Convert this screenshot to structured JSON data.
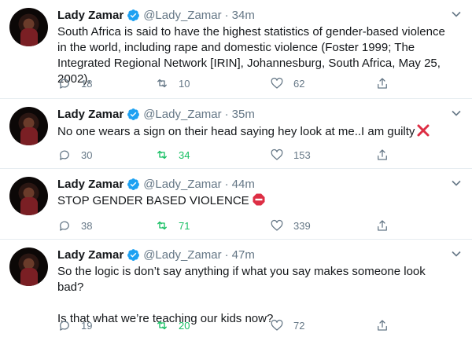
{
  "tweets": [
    {
      "name": "Lady Zamar",
      "handle": "@Lady_Zamar",
      "time": "34m",
      "text": [
        "South Africa is said to have the highest statistics of gender-based violence in the world, including rape and domestic violence (Foster 1999; The Integrated Regional Network [IRIN], Johannesburg, South Africa, May 25, 2002)."
      ],
      "emoji": "",
      "replies": "18",
      "retweets": "10",
      "retweeted": false,
      "likes": "62"
    },
    {
      "name": "Lady Zamar",
      "handle": "@Lady_Zamar",
      "time": "35m",
      "text": [
        "No one wears a sign on their head saying hey look at me..I am guilty"
      ],
      "emoji": "cross-mark-icon",
      "replies": "30",
      "retweets": "34",
      "retweeted": true,
      "likes": "153"
    },
    {
      "name": "Lady Zamar",
      "handle": "@Lady_Zamar",
      "time": "44m",
      "text": [
        "STOP GENDER BASED VIOLENCE"
      ],
      "emoji": "stop-sign-icon",
      "replies": "38",
      "retweets": "71",
      "retweeted": true,
      "likes": "339"
    },
    {
      "name": "Lady Zamar",
      "handle": "@Lady_Zamar",
      "time": "47m",
      "text": [
        "So the logic is don’t say anything if what you say makes someone look bad?",
        "Is that what we’re teaching our kids now?"
      ],
      "emoji": "",
      "replies": "19",
      "retweets": "20",
      "retweeted": true,
      "likes": "72"
    }
  ],
  "colors": {
    "accent": "#1da1f2",
    "retweet_active": "#17bf63",
    "secondary_text": "#657786",
    "divider": "#e6ecf0"
  }
}
